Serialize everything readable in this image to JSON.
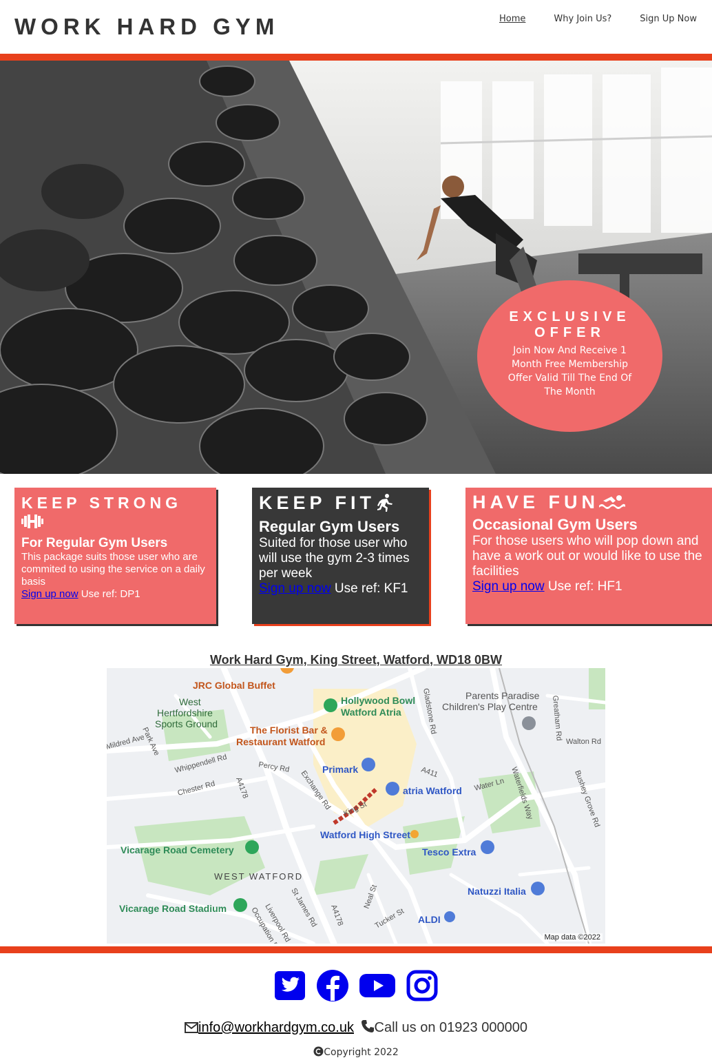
{
  "header": {
    "logo": "WORK HARD GYM",
    "nav": [
      "Home",
      "Why Join Us?",
      "Sign Up Now"
    ]
  },
  "offer": {
    "title": "EXCLUSIVE OFFER",
    "text": "Join Now And Receive 1 Month Free Membership Offer Valid Till The End Of The Month"
  },
  "cards": [
    {
      "title": "KEEP STRONG",
      "icon": "dumbbell-icon",
      "subtitle": "For Regular Gym Users",
      "text": "This package suits those user who are commited to using the service on a daily basis",
      "link": "Sign up now",
      "ref": "Use ref: DP1"
    },
    {
      "title": "KEEP FIT",
      "icon": "running-icon",
      "subtitle": "Regular Gym Users",
      "text": "Suited for those user who will use the gym 2-3 times per week",
      "link": "Sign up now",
      "ref": "Use ref: KF1"
    },
    {
      "title": "HAVE FUN",
      "icon": "swimmer-icon",
      "subtitle": "Occasional Gym Users",
      "text": "For those users who will pop down and have a work out or would like to use the facilities",
      "link": "Sign up now",
      "ref": "Use ref: HF1"
    }
  ],
  "address": "Work Hard Gym, King Street, Watford, WD18 0BW",
  "map": {
    "labels": {
      "jrc": "JRC Global Buffet",
      "hollywood1": "Hollywood Bowl",
      "hollywood2": "Watford Atria",
      "parents1": "Parents Paradise",
      "parents2": "Children's Play Centre",
      "westherts1": "West",
      "westherts2": "Hertfordshire",
      "westherts3": "Sports Ground",
      "florist1": "The Florist Bar &",
      "florist2": "Restaurant Watford",
      "primark": "Primark",
      "atria": "atria Watford",
      "highstreet": "Watford High Street",
      "tesco": "Tesco Extra",
      "cemetery": "Vicarage Road Cemetery",
      "westwatford": "WEST WATFORD",
      "natuzzi": "Natuzzi Italia",
      "stadium": "Vicarage Road Stadium",
      "aldi": "ALDI",
      "a4178a": "A4178",
      "a4178b": "A4178",
      "a411": "A411",
      "exchange": "Exchange Rd",
      "kingst": "King St",
      "waterln": "Water Ln",
      "waterfields": "Waterfields Way",
      "greatham": "Greatham Rd",
      "walton": "Walton Rd",
      "bushey": "Bushey Grove Rd",
      "gladstone": "Gladstone Rd",
      "parkave": "Park Ave",
      "mildred": "Mildred Ave",
      "whippendell": "Whippendell Rd",
      "chester": "Chester Rd",
      "percy": "Percy Rd",
      "stjames": "St James Rd",
      "liverpool": "Liverpool Rd",
      "occupation": "Occupation Rd",
      "neal": "Neal St",
      "tucker": "Tucker St"
    },
    "credit": "Map data ©2022"
  },
  "footer": {
    "social": [
      "twitter-icon",
      "facebook-icon",
      "youtube-icon",
      "instagram-icon"
    ],
    "email": "info@workhardgym.co.uk",
    "phone": "Call us on 01923 000000",
    "copyright": "Copyright 2022"
  },
  "colors": {
    "accent": "#e8401c",
    "card_red": "#f06a6a",
    "card_dark": "#383838",
    "social_blue": "#0000ee"
  }
}
